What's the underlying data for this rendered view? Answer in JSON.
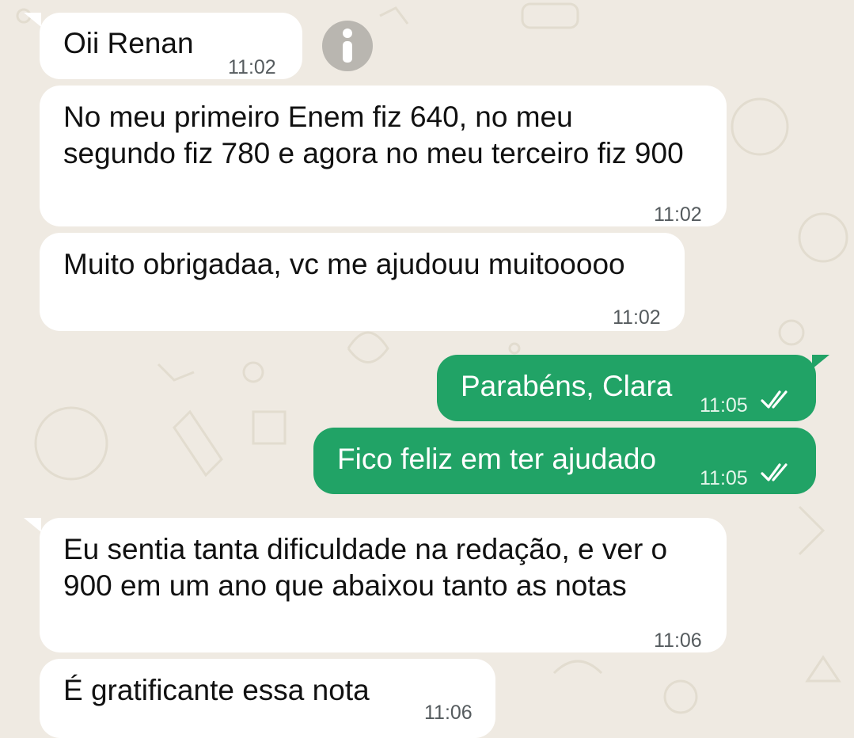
{
  "messages": [
    {
      "id": "m1",
      "direction": "incoming",
      "text": "Oii Renan",
      "time": "11:02"
    },
    {
      "id": "m2",
      "direction": "incoming",
      "text": "No meu primeiro Enem fiz 640, no meu segundo fiz 780 e agora no meu terceiro fiz 900",
      "time": "11:02"
    },
    {
      "id": "m3",
      "direction": "incoming",
      "text": "Muito obrigadaa, vc me ajudouu muitooooo",
      "time": "11:02"
    },
    {
      "id": "m4",
      "direction": "outgoing",
      "text": "Parabéns, Clara",
      "time": "11:05",
      "status": "read"
    },
    {
      "id": "m5",
      "direction": "outgoing",
      "text": "Fico feliz em ter ajudado",
      "time": "11:05",
      "status": "read"
    },
    {
      "id": "m6",
      "direction": "incoming",
      "text": "Eu sentia tanta dificuldade na redação, e ver o 900 em um ano que abaixou tanto as notas",
      "time": "11:06"
    },
    {
      "id": "m7",
      "direction": "incoming",
      "text": "É gratificante essa nota",
      "time": "11:06"
    }
  ],
  "icons": {
    "info": "info-icon",
    "read_receipt": "double-check-icon"
  },
  "colors": {
    "background": "#efeae2",
    "incoming_bubble": "#ffffff",
    "outgoing_bubble": "#21a366"
  }
}
